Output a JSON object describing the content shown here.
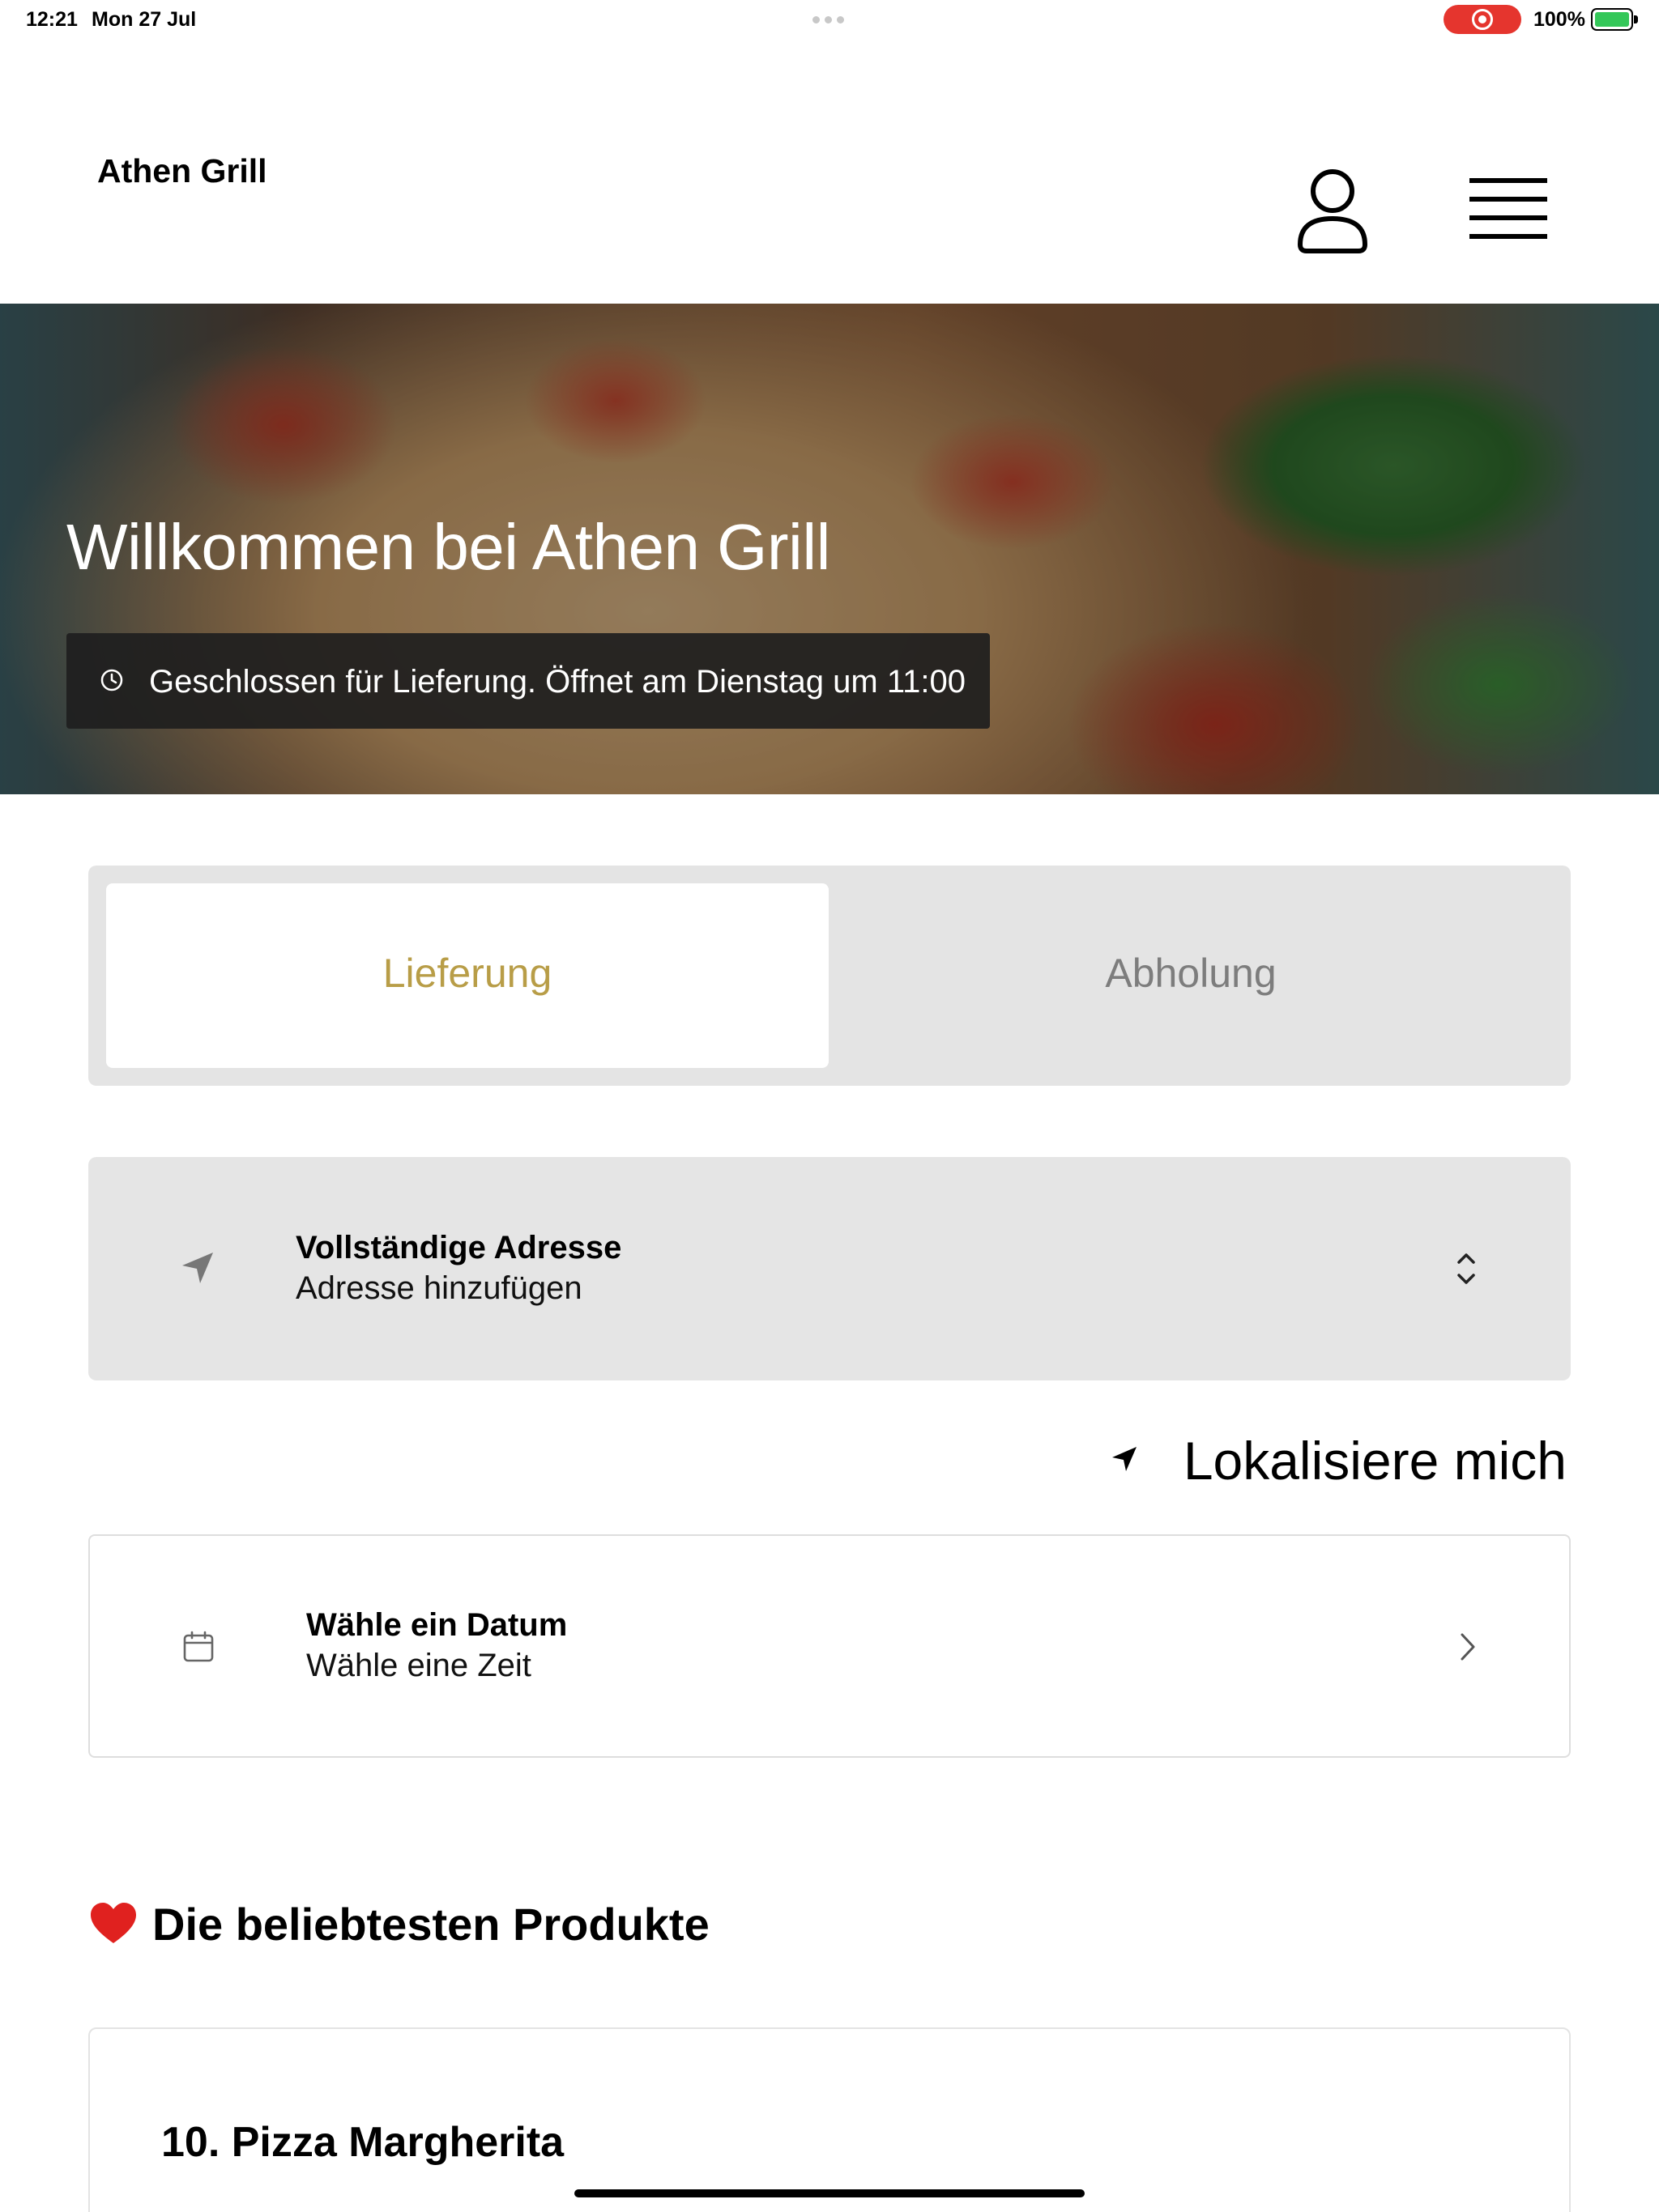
{
  "status_bar": {
    "time": "12:21",
    "date": "Mon 27 Jul",
    "battery": "100%",
    "recording_color": "#e5352e",
    "battery_color": "#34c759"
  },
  "header": {
    "brand": "Athen Grill",
    "user_icon": "user-icon",
    "menu_icon": "hamburger-menu-icon"
  },
  "hero": {
    "title": "Willkommen bei Athen Grill",
    "status_text": "Geschlossen für Lieferung. Öffnet am Dienstag um 11:00",
    "status_icon": "clock-icon"
  },
  "order_mode": {
    "tabs": [
      {
        "label": "Lieferung",
        "active": true
      },
      {
        "label": "Abholung",
        "active": false
      }
    ],
    "active_color": "#b89d47"
  },
  "address": {
    "title": "Vollständige Adresse",
    "placeholder": "Adresse hinzufügen",
    "icon": "location-arrow-icon"
  },
  "locate": {
    "label": "Lokalisiere mich",
    "icon": "location-arrow-icon"
  },
  "schedule": {
    "date_label": "Wähle ein Datum",
    "time_label": "Wähle eine Zeit",
    "icon": "calendar-icon"
  },
  "popular": {
    "heading": "Die beliebtesten Produkte",
    "icon": "heart-icon",
    "products": [
      {
        "name": "10. Pizza Margherita"
      }
    ]
  }
}
